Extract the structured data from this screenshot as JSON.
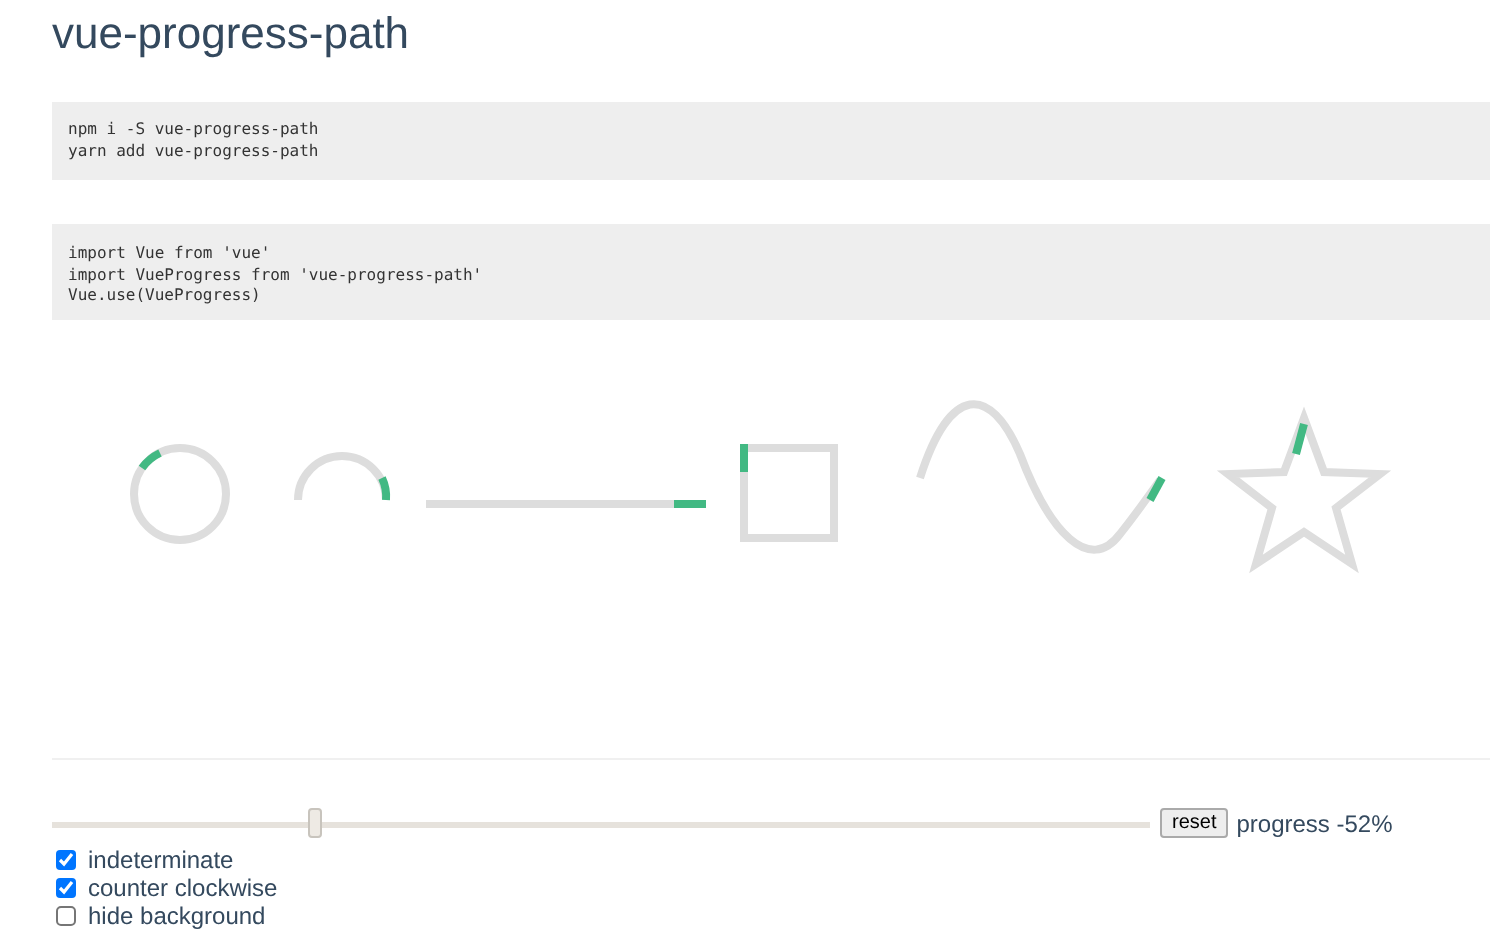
{
  "title": "vue-progress-path",
  "code_blocks": [
    [
      "npm i -S vue-progress-path",
      "yarn add vue-progress-path"
    ],
    [
      "import Vue from 'vue'",
      "import VueProgress from 'vue-progress-path'",
      "Vue.use(VueProgress)"
    ]
  ],
  "slider": {
    "level": 0.24
  },
  "reset_button": "reset",
  "progress_label": "progress -52%",
  "options": [
    {
      "label": "indeterminate",
      "checked": true
    },
    {
      "label": "counter clockwise",
      "checked": true
    },
    {
      "label": "hide background",
      "checked": false
    }
  ]
}
